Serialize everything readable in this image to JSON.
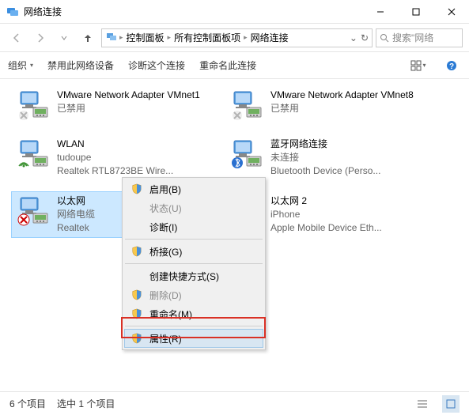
{
  "title": "网络连接",
  "breadcrumb": [
    "控制面板",
    "所有控制面板项",
    "网络连接"
  ],
  "search_placeholder": "搜索\"网络",
  "toolbar": {
    "organize": "组织",
    "disable": "禁用此网络设备",
    "diagnose": "诊断这个连接",
    "rename": "重命名此连接"
  },
  "adapters": [
    {
      "name": "VMware Network Adapter VMnet1",
      "status": "已禁用",
      "device": "",
      "overlay": "down"
    },
    {
      "name": "VMware Network Adapter VMnet8",
      "status": "已禁用",
      "device": "",
      "overlay": "down"
    },
    {
      "name": "WLAN",
      "status": "tudoupe",
      "device": "Realtek RTL8723BE Wire...",
      "overlay": "wifi"
    },
    {
      "name": "蓝牙网络连接",
      "status": "未连接",
      "device": "Bluetooth Device (Perso...",
      "overlay": "bt"
    },
    {
      "name": "以太网",
      "status": "网络电缆",
      "device": "Realtek",
      "overlay": "x",
      "selected": true
    },
    {
      "name": "以太网 2",
      "status": "iPhone",
      "device": "Apple Mobile Device Eth...",
      "overlay": "none"
    }
  ],
  "context_menu": [
    {
      "label": "启用(B)",
      "icon": "shield",
      "enabled": true
    },
    {
      "label": "状态(U)",
      "icon": "",
      "enabled": false
    },
    {
      "label": "诊断(I)",
      "icon": "",
      "enabled": true
    },
    {
      "sep": true
    },
    {
      "label": "桥接(G)",
      "icon": "shield",
      "enabled": true
    },
    {
      "sep": true
    },
    {
      "label": "创建快捷方式(S)",
      "icon": "",
      "enabled": true
    },
    {
      "label": "删除(D)",
      "icon": "shield",
      "enabled": false
    },
    {
      "label": "重命名(M)",
      "icon": "shield",
      "enabled": true
    },
    {
      "sep": true
    },
    {
      "label": "属性(R)",
      "icon": "shield",
      "enabled": true,
      "hover": true
    }
  ],
  "status": {
    "count": "6 个项目",
    "selected": "选中 1 个项目"
  }
}
